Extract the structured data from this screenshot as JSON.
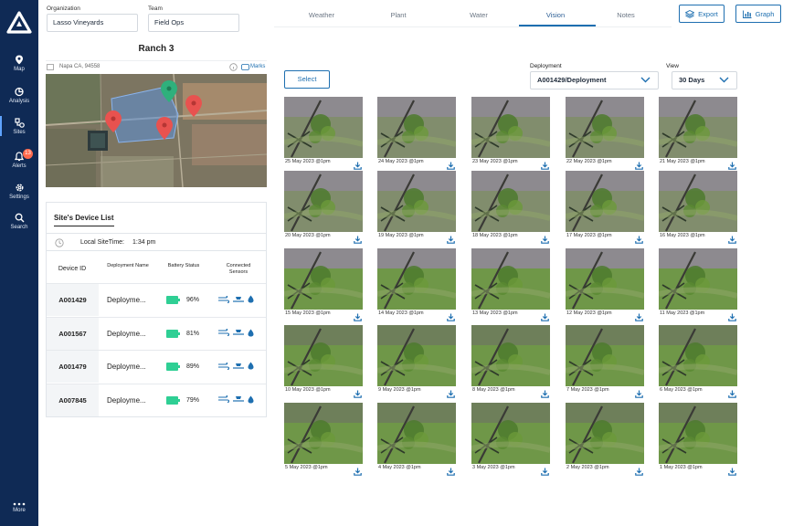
{
  "sidebar": {
    "items": [
      {
        "label": "Map",
        "icon": "map-pin-icon"
      },
      {
        "label": "Analysis",
        "icon": "analysis-icon"
      },
      {
        "label": "Sites",
        "icon": "sites-icon"
      },
      {
        "label": "Alerts",
        "icon": "bell-icon",
        "badge": "13"
      },
      {
        "label": "Settings",
        "icon": "gear-icon"
      },
      {
        "label": "Search",
        "icon": "search-icon"
      }
    ],
    "more_label": "More"
  },
  "header": {
    "organization_label": "Organization",
    "organization_value": "Lasso Vineyards",
    "team_label": "Team",
    "team_value": "Field Ops",
    "tabs": [
      {
        "label": "Weather"
      },
      {
        "label": "Plant"
      },
      {
        "label": "Water"
      },
      {
        "label": "Vision",
        "active": true
      },
      {
        "label": "Notes"
      }
    ],
    "export_label": "Export",
    "graph_label": "Graph"
  },
  "ranch": {
    "title": "Ranch 3",
    "address": "Napa CA, 94558",
    "marks_label": "Marks"
  },
  "device_list": {
    "title": "Site's Device List",
    "local_time_label": "Local SiteTime:",
    "local_time_value": "1:34 pm",
    "columns": [
      "Device ID",
      "Deployment Name",
      "Battery Status",
      "Connected Sensors"
    ],
    "rows": [
      {
        "id": "A001429",
        "name": "Deployme...",
        "battery": "96%"
      },
      {
        "id": "A001567",
        "name": "Deployme...",
        "battery": "81%"
      },
      {
        "id": "A001479",
        "name": "Deployme...",
        "battery": "89%"
      },
      {
        "id": "A007845",
        "name": "Deployme...",
        "battery": "79%"
      }
    ]
  },
  "vision": {
    "select_label": "Select",
    "deployment_label": "Deployment",
    "deployment_value": "A001429/Deployment",
    "view_label": "View",
    "view_value": "30 Days",
    "images": [
      "25 May 2023 @1pm",
      "24 May 2023 @1pm",
      "23 May 2023 @1pm",
      "22 May 2023 @1pm",
      "21 May 2023 @1pm",
      "20 May 2023 @1pm",
      "19 May 2023 @1pm",
      "18 May 2023 @1pm",
      "17 May 2023 @1pm",
      "16 May 2023 @1pm",
      "15 May 2023 @1pm",
      "14 May 2023 @1pm",
      "13 May 2023 @1pm",
      "12 May 2023 @1pm",
      "11 May 2023 @1pm",
      "10 May 2023 @1pm",
      "9 May 2023 @1pm",
      "8 May 2023 @1pm",
      "7 May 2023 @1pm",
      "6 May 2023 @1pm",
      "5 May 2023 @1pm",
      "4 May 2023 @1pm",
      "3 May 2023 @1pm",
      "2 May 2023 @1pm",
      "1 May 2023 @1pm"
    ]
  },
  "colors": {
    "sidebar_bg": "#0f2a55",
    "accent": "#1e6fb0",
    "battery": "#2fcf94",
    "alert_badge": "#ff6a4d",
    "map_pin_red": "#e8524f",
    "map_pin_green": "#2fb07c"
  }
}
